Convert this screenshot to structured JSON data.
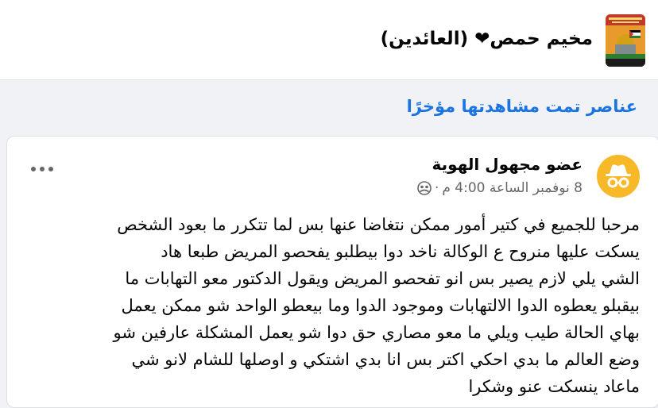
{
  "header": {
    "group_name": "مخيم حمص❤ (العائدين)",
    "group_avatar_icon": "group-cover-image"
  },
  "section": {
    "title": "عناصر تمت مشاهدتها مؤخرًا"
  },
  "post": {
    "author": "عضو مجهول الهوية",
    "author_avatar_icon": "anonymous-member-icon",
    "date": "8 نوفمبر الساعة 4:00 م",
    "separator": "·",
    "privacy_icon": "group-members-icon",
    "more_icon": "more-options-icon",
    "text": "مرحبا للجميع في كتير أمور ممكن نتغاضا عنها بس لما تتكرر ما بعود الشخص\nيسكت عليها منروح ع الوكالة ناخد دوا   بيطلبو يفحصو المريض   طبعا هاد\nالشي يلي لازم يصير بس انو تفحصو المريض ويقول الدكتور معو التهابات ما\nبيقبلو يعطوه الدوا الالتهابات وموجود الدوا وما بيعطو الواحد شو ممكن يعمل\nبهاي الحالة طيب ويلي ما معو مصاري حق دوا شو يعمل المشكلة عارفين شو\nوضع العالم ما بدي احكي اكتر بس انا بدي اشتكي و اوصلها للشام لانو شي\nماعاد ينسكت عنو وشكرا"
  },
  "colors": {
    "page_bg": "#f0f2f5",
    "link_blue": "#1b74e4",
    "anonymous_avatar": "#f7b928",
    "secondary_text": "#65676b"
  }
}
